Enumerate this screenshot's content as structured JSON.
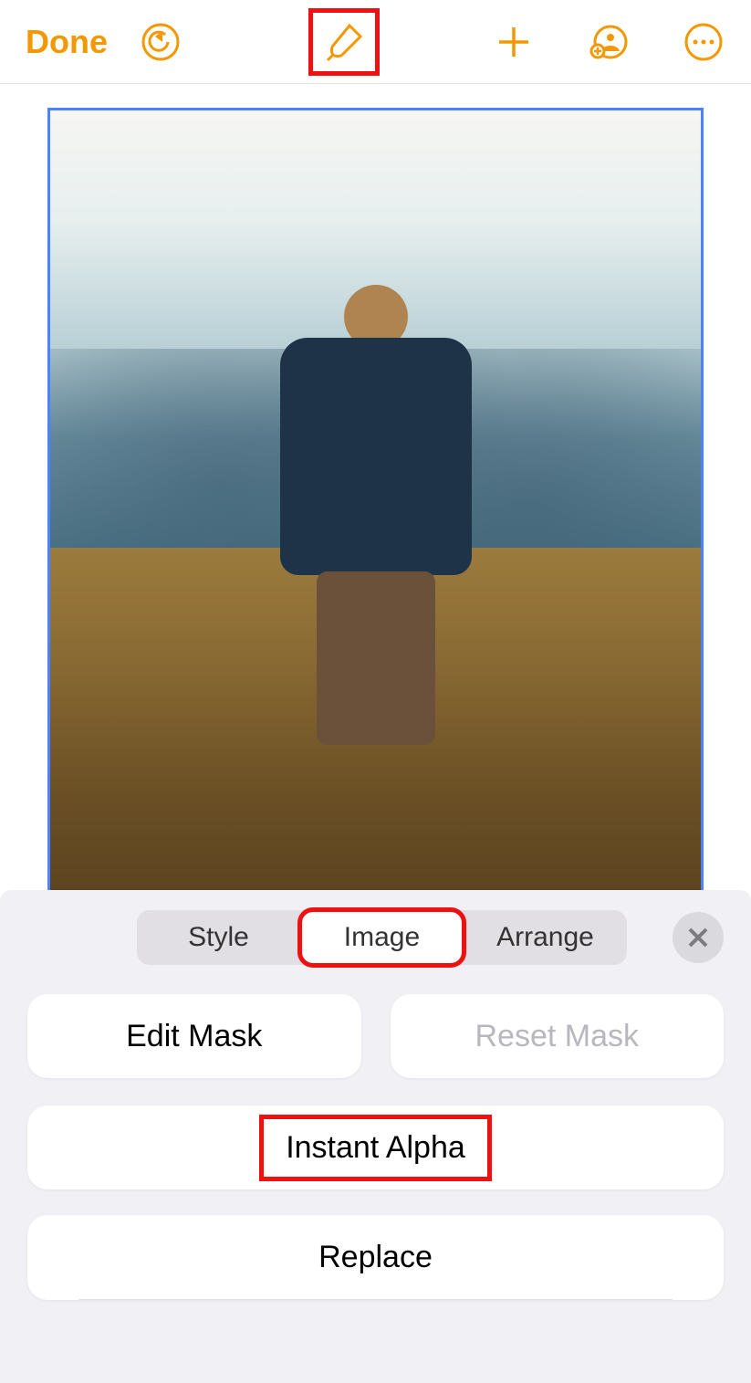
{
  "toolbar": {
    "done_label": "Done"
  },
  "panel": {
    "tabs": {
      "style": "Style",
      "image": "Image",
      "arrange": "Arrange"
    },
    "buttons": {
      "edit_mask": "Edit Mask",
      "reset_mask": "Reset Mask",
      "instant_alpha": "Instant Alpha",
      "replace": "Replace"
    }
  },
  "highlights": {
    "brush_icon": true,
    "image_tab": true,
    "instant_alpha": true
  }
}
